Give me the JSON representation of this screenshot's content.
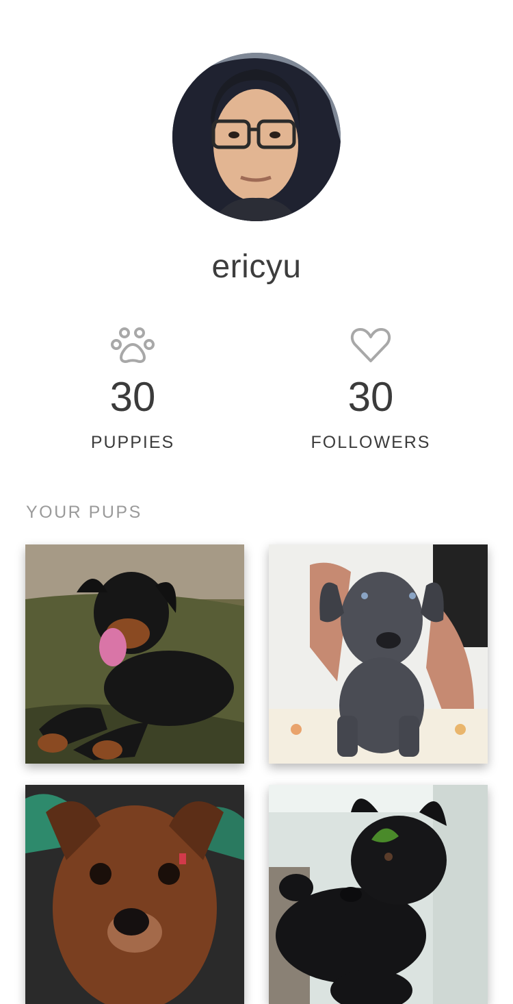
{
  "profile": {
    "username": "ericyu",
    "avatar_icon": "profile-photo"
  },
  "stats": {
    "puppies": {
      "count": "30",
      "label": "PUPPIES",
      "icon": "paw-icon"
    },
    "followers": {
      "count": "30",
      "label": "FOLLOWERS",
      "icon": "heart-icon"
    }
  },
  "pups_section": {
    "title": "YOUR PUPS",
    "items": [
      {
        "icon": "rottweiler-puppy-photo"
      },
      {
        "icon": "grey-labrador-puppy-photo"
      },
      {
        "icon": "brown-puppy-photo"
      },
      {
        "icon": "black-shepherd-puppy-photo"
      }
    ]
  },
  "colors": {
    "text": "#3b3b3b",
    "muted": "#9a9a9a",
    "icon": "#a8a8a8",
    "background": "#ffffff"
  }
}
